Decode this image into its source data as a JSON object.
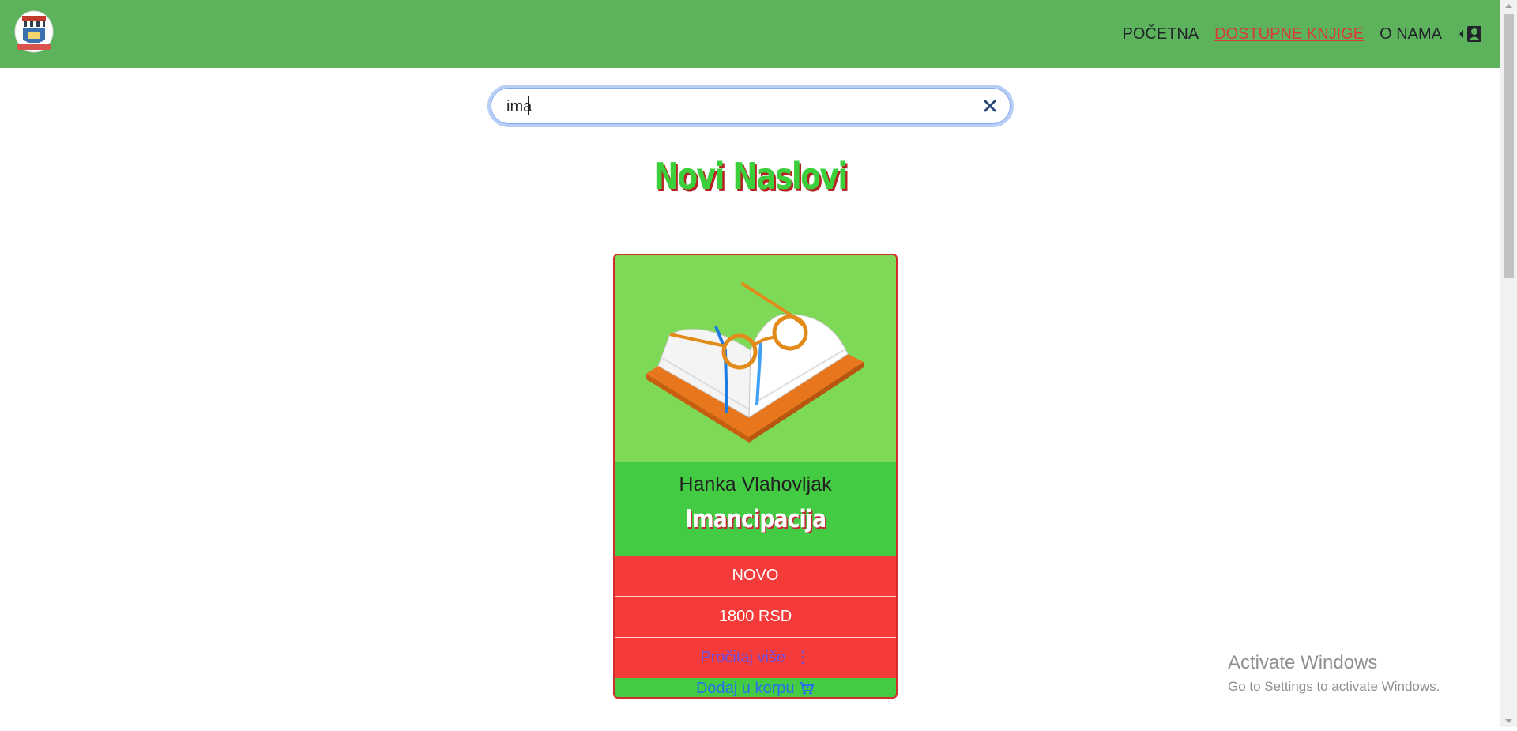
{
  "nav": {
    "links": [
      {
        "label": "POČETNA"
      },
      {
        "label": "DOSTUPNE KNJIGE"
      },
      {
        "label": "O NAMA"
      }
    ],
    "logo": "library-logo-icon",
    "account_icon": "user-account-icon"
  },
  "search": {
    "value": "ima",
    "clear_icon": "close-icon"
  },
  "section": {
    "title": "Novi Naslovi"
  },
  "book": {
    "author": "Hanka Vlahovljak",
    "title": "Imancipacija",
    "badge": "NOVO",
    "price": "1800 RSD",
    "read_more": "Pročitaj više",
    "read_more_icon": "vertical-dots-icon",
    "add_to_cart": "Dodaj u korpu",
    "cart_icon": "cart-plus-icon",
    "image": "open-book-with-glasses-image"
  },
  "watermark": {
    "line1": "Activate Windows",
    "line2": "Go to Settings to activate Windows."
  },
  "colors": {
    "navbar": "#5cb35c",
    "card_green": "#43cb43",
    "card_red": "#f53a3a",
    "active_link": "#d83a3a"
  }
}
